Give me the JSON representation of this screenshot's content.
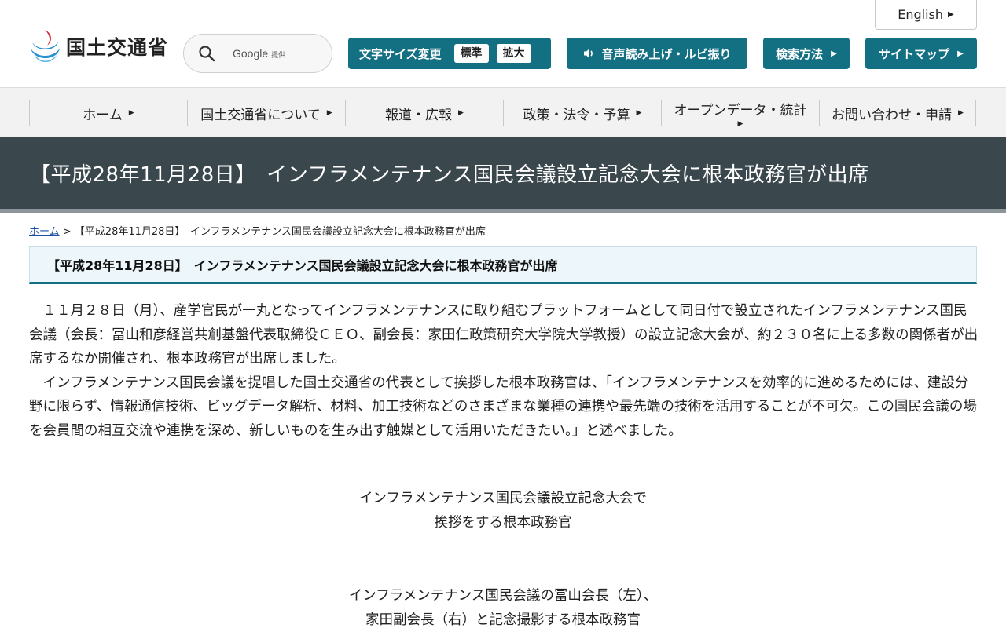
{
  "header": {
    "english_label": "English",
    "logo_text": "国土交通省",
    "search": {
      "brand": "Google",
      "provided": "提供"
    },
    "font_size": {
      "label": "文字サイズ変更",
      "standard": "標準",
      "large": "拡大"
    },
    "voice_label": "音声読み上げ・ルビ振り",
    "search_help_label": "検索方法",
    "sitemap_label": "サイトマップ"
  },
  "nav": {
    "items": [
      {
        "label": "ホーム"
      },
      {
        "label": "国土交通省について"
      },
      {
        "label": "報道・広報"
      },
      {
        "label": "政策・法令・予算"
      },
      {
        "label": "オープンデータ・統計"
      },
      {
        "label": "お問い合わせ・申請"
      }
    ]
  },
  "page": {
    "title": "【平成28年11月28日】　インフラメンテナンス国民会議設立記念大会に根本政務官が出席",
    "breadcrumb": {
      "home": "ホーム",
      "separator": " > ",
      "current": "【平成28年11月28日】　インフラメンテナンス国民会議設立記念大会に根本政務官が出席"
    },
    "heading": "【平成28年11月28日】　インフラメンテナンス国民会議設立記念大会に根本政務官が出席",
    "paragraphs": [
      "　１１月２８日（月）、産学官民が一丸となってインフラメンテナンスに取り組むプラットフォームとして同日付で設立されたインフラメンテナンス国民会議（会長：冨山和彦経営共創基盤代表取締役ＣＥＯ、副会長：家田仁政策研究大学院大学教授）の設立記念大会が、約２３０名に上る多数の関係者が出席するなか開催され、根本政務官が出席しました。",
      "　インフラメンテナンス国民会議を提唱した国土交通省の代表として挨拶した根本政務官は、「インフラメンテナンスを効率的に進めるためには、建設分野に限らず、情報通信技術、ビッグデータ解析、材料、加工技術などのさまざまな業種の連携や最先端の技術を活用することが不可欠。この国民会議の場を会員間の相互交流や連携を深め、新しいものを生み出す触媒として活用いただきたい。」と述べました。"
    ],
    "captions": [
      {
        "line1": "インフラメンテナンス国民会議設立記念大会で",
        "line2": "挨拶をする根本政務官"
      },
      {
        "line1": "インフラメンテナンス国民会議の冨山会長（左）、",
        "line2": "家田副会長（右）と記念撮影する根本政務官"
      }
    ]
  },
  "colors": {
    "accent": "#136f82",
    "banner": "#3a474d",
    "nav_bg": "#f2f2f2",
    "heading_bg": "#edf6fa",
    "link": "#1a4fa8"
  }
}
